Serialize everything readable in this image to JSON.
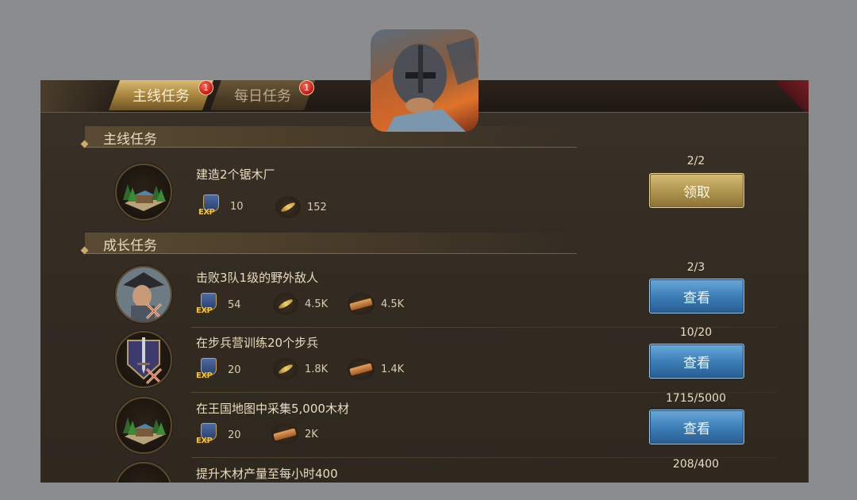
{
  "tabs": [
    {
      "label": "主线任务",
      "badge": "1"
    },
    {
      "label": "每日任务",
      "badge": "1"
    }
  ],
  "sections": {
    "main": {
      "title": "主线任务"
    },
    "growth": {
      "title": "成长任务"
    }
  },
  "tasks": [
    {
      "title": "建造2个锯木厂",
      "progress": "2/2",
      "button": "领取",
      "rewards": {
        "exp": "10",
        "food": "152"
      }
    },
    {
      "title": "击败3队1级的野外敌人",
      "progress": "2/3",
      "button": "查看",
      "rewards": {
        "exp": "54",
        "food": "4.5K",
        "wood": "4.5K"
      }
    },
    {
      "title": "在步兵营训练20个步兵",
      "progress": "10/20",
      "button": "查看",
      "rewards": {
        "exp": "20",
        "food": "1.8K",
        "wood": "1.4K"
      }
    },
    {
      "title": "在王国地图中采集5,000木材",
      "progress": "1715/5000",
      "button": "查看",
      "rewards": {
        "exp": "20",
        "wood": "2K"
      }
    },
    {
      "title": "提升木材产量至每小时400",
      "progress": "208/400"
    }
  ],
  "icons": {
    "exp_text": "EXP",
    "exp": "exp-icon",
    "food": "wheat-icon",
    "wood": "wood-icon"
  },
  "colors": {
    "claim_button": "#b59a55",
    "view_button": "#3d7fb8",
    "badge": "#c01612"
  }
}
